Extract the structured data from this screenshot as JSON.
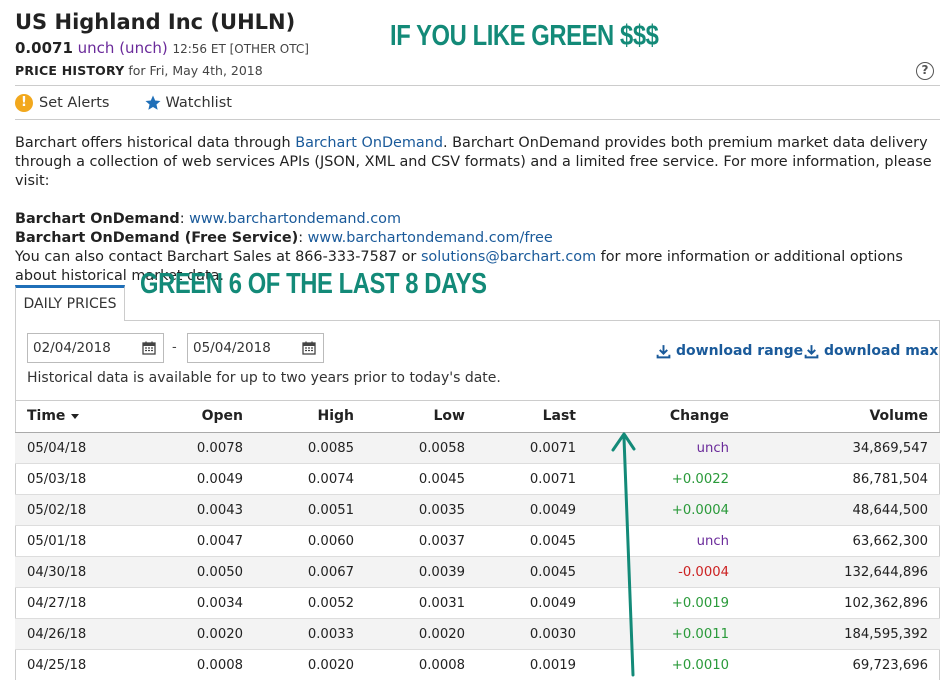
{
  "header": {
    "title": "US Highland Inc (UHLN)",
    "price": "0.0071",
    "change": "unch (unch)",
    "time": "12:56 ET [OTHER OTC]",
    "history_label": "PRICE HISTORY",
    "history_date": "for Fri, May 4th, 2018",
    "help": "?"
  },
  "actions": {
    "alerts": "Set Alerts",
    "watchlist": "Watchlist",
    "alert_glyph": "!"
  },
  "info": {
    "p1_a": "Barchart offers historical data through ",
    "p1_link": "Barchart OnDemand",
    "p1_b": ". Barchart OnDemand provides both premium market data delivery through a collection of web services APIs (JSON, XML and CSV formats) and a limited free service. For more information, please visit:",
    "od_label": "Barchart OnDemand",
    "od_url": "www.barchartondemand.com",
    "free_label": "Barchart OnDemand (Free Service)",
    "free_url": "www.barchartondemand.com/free",
    "contact_a": "You can also contact Barchart Sales at 866-333-7587 or ",
    "contact_link": "solutions@barchart.com",
    "contact_b": " for more information or additional options about historical market data."
  },
  "overlays": {
    "top": "IF YOU LIKE GREEN $$$",
    "mid": "GREEN 6 OF THE LAST 8 DAYS"
  },
  "tab": "DAILY PRICES",
  "range": {
    "from": "02/04/2018",
    "to": "05/04/2018",
    "sep": "-"
  },
  "download": {
    "range": "download range",
    "max": "download max"
  },
  "note": "Historical data is available for up to two years prior to today's date.",
  "columns": {
    "time": "Time",
    "open": "Open",
    "high": "High",
    "low": "Low",
    "last": "Last",
    "change": "Change",
    "volume": "Volume"
  },
  "rows": [
    {
      "time": "05/04/18",
      "open": "0.0078",
      "high": "0.0085",
      "low": "0.0058",
      "last": "0.0071",
      "change": "unch",
      "volume": "34,869,547"
    },
    {
      "time": "05/03/18",
      "open": "0.0049",
      "high": "0.0074",
      "low": "0.0045",
      "last": "0.0071",
      "change": "+0.0022",
      "volume": "86,781,504"
    },
    {
      "time": "05/02/18",
      "open": "0.0043",
      "high": "0.0051",
      "low": "0.0035",
      "last": "0.0049",
      "change": "+0.0004",
      "volume": "48,644,500"
    },
    {
      "time": "05/01/18",
      "open": "0.0047",
      "high": "0.0060",
      "low": "0.0037",
      "last": "0.0045",
      "change": "unch",
      "volume": "63,662,300"
    },
    {
      "time": "04/30/18",
      "open": "0.0050",
      "high": "0.0067",
      "low": "0.0039",
      "last": "0.0045",
      "change": "-0.0004",
      "volume": "132,644,896"
    },
    {
      "time": "04/27/18",
      "open": "0.0034",
      "high": "0.0052",
      "low": "0.0031",
      "last": "0.0049",
      "change": "+0.0019",
      "volume": "102,362,896"
    },
    {
      "time": "04/26/18",
      "open": "0.0020",
      "high": "0.0033",
      "low": "0.0020",
      "last": "0.0030",
      "change": "+0.0011",
      "volume": "184,595,392"
    },
    {
      "time": "04/25/18",
      "open": "0.0008",
      "high": "0.0020",
      "low": "0.0008",
      "last": "0.0019",
      "change": "+0.0010",
      "volume": "69,723,696"
    }
  ],
  "colors": {
    "positive": "#2a9a3a",
    "negative": "#cc2222",
    "unchanged": "#6a2a9a",
    "annotation": "#138a78"
  }
}
